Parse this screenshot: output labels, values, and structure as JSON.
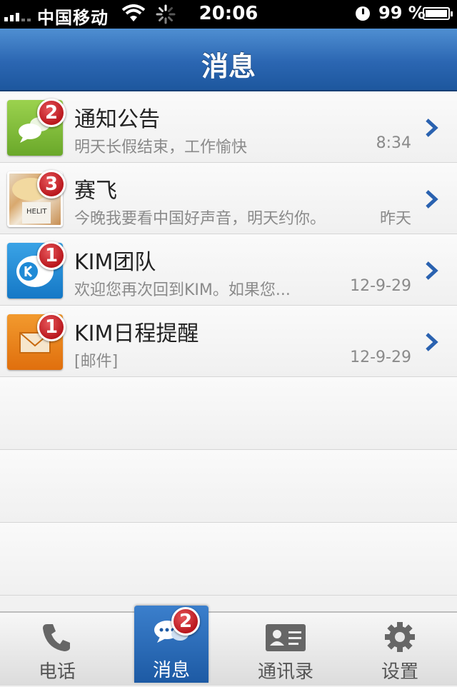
{
  "status_bar": {
    "carrier": "中国移动",
    "time": "20:06",
    "battery_percent": "99 %",
    "icons": [
      "signal-icon",
      "wifi-icon",
      "activity-spinner-icon",
      "alarm-icon",
      "battery-charging-icon"
    ]
  },
  "nav": {
    "title": "消息"
  },
  "messages": [
    {
      "name": "通知公告",
      "preview": "明天长假结束，工作愉快",
      "time": "8:34",
      "badge": "2",
      "avatar_icon": "notice-chat-icon",
      "avatar_color": "#7ab83a"
    },
    {
      "name": "赛飞",
      "preview": "今晚我要看中国好声音，明天约你。",
      "time": "昨天",
      "badge": "3",
      "avatar_icon": "user-photo",
      "avatar_color": "#d9a96e"
    },
    {
      "name": "KIM团队",
      "preview": "欢迎您再次回到KIM。如果您...",
      "time": "12-9-29",
      "badge": "1",
      "avatar_icon": "kim-logo-icon",
      "avatar_color": "#1f8ad6"
    },
    {
      "name": "KIM日程提醒",
      "preview": "[邮件]",
      "time": "12-9-29",
      "badge": "1",
      "avatar_icon": "mail-envelope-icon",
      "avatar_color": "#e8800f"
    }
  ],
  "tabs": [
    {
      "label": "电话",
      "icon": "phone-icon",
      "active": false
    },
    {
      "label": "消息",
      "icon": "chat-bubbles-icon",
      "active": true,
      "badge": "2"
    },
    {
      "label": "通讯录",
      "icon": "contact-card-icon",
      "active": false
    },
    {
      "label": "设置",
      "icon": "gear-icon",
      "active": false
    }
  ],
  "colors": {
    "nav_blue": "#2b66b2",
    "badge_red": "#c0262b",
    "chevron_blue": "#2a62b0"
  }
}
